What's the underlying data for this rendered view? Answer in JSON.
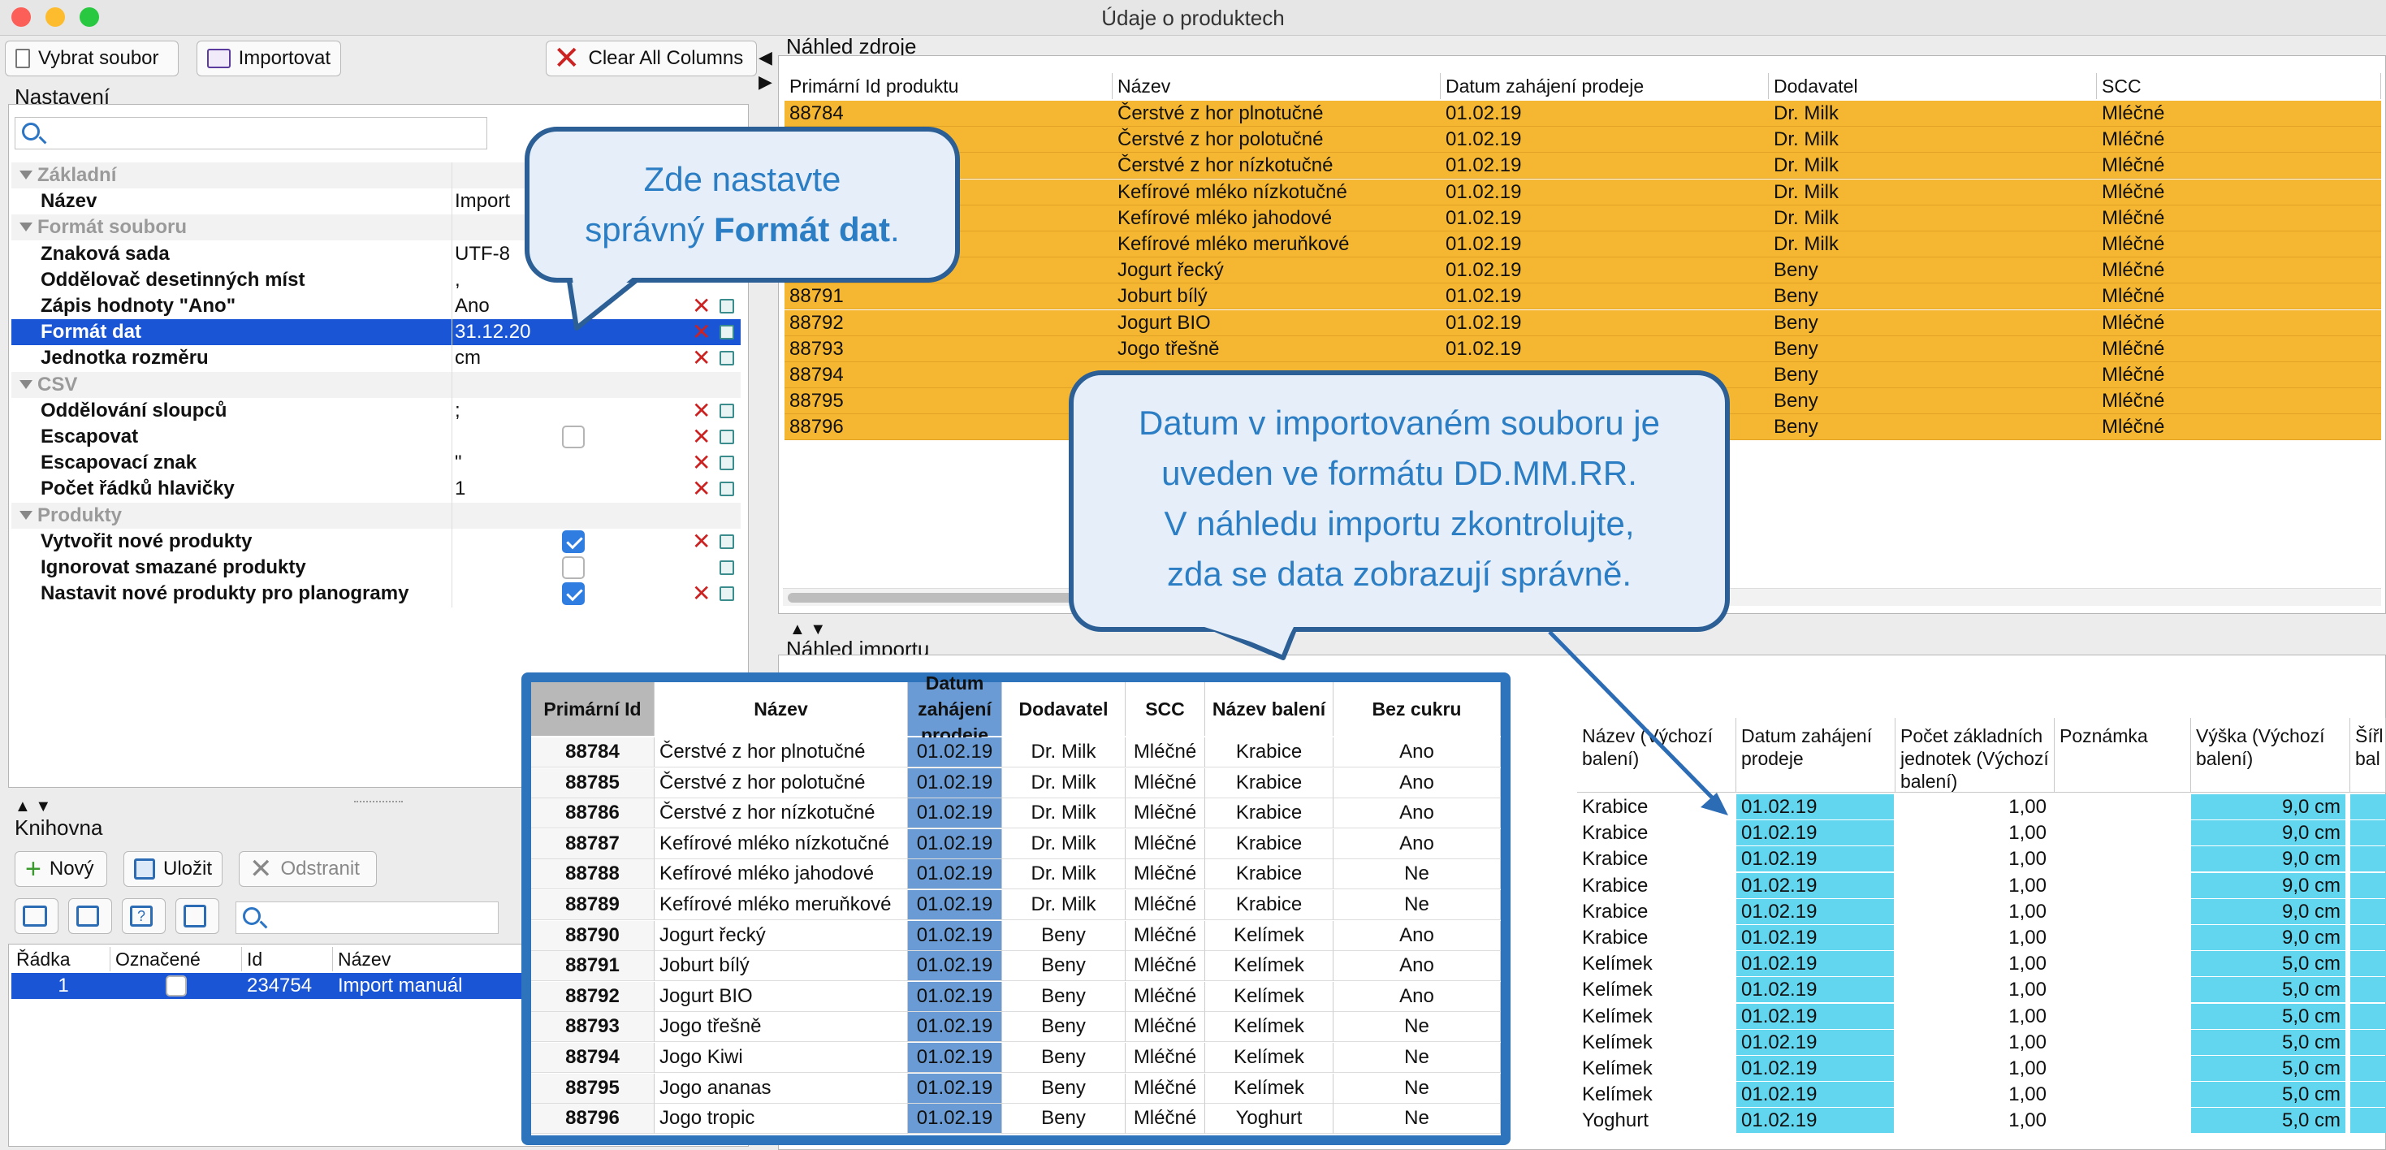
{
  "window": {
    "title": "Údaje o produktech"
  },
  "toolbar": {
    "select_file": "Vybrat soubor",
    "import": "Importovat",
    "clear_all": "Clear All Columns"
  },
  "settings": {
    "title": "Nastavení",
    "rows": [
      {
        "type": "group",
        "label": "Základní"
      },
      {
        "type": "prop",
        "label": "Název",
        "value": "Import",
        "icons": false
      },
      {
        "type": "group",
        "label": "Formát souboru"
      },
      {
        "type": "prop",
        "label": "Znaková sada",
        "value": "UTF-8",
        "icons": false
      },
      {
        "type": "prop",
        "label": "Oddělovač desetinných míst",
        "value": ",",
        "icons": false
      },
      {
        "type": "prop",
        "label": "Zápis hodnoty \"Ano\"",
        "value": "Ano",
        "icons": true
      },
      {
        "type": "prop",
        "label": "Formát dat",
        "value": "31.12.20",
        "icons": true,
        "selected": true
      },
      {
        "type": "prop",
        "label": "Jednotka rozměru",
        "value": "cm",
        "icons": true
      },
      {
        "type": "group",
        "label": "CSV"
      },
      {
        "type": "prop",
        "label": "Oddělování sloupců",
        "value": ";",
        "icons": true
      },
      {
        "type": "prop",
        "label": "Escapovat",
        "value": "",
        "checkbox": false,
        "icons": true
      },
      {
        "type": "prop",
        "label": "Escapovací znak",
        "value": "\"",
        "icons": true
      },
      {
        "type": "prop",
        "label": "Počet řádků hlavičky",
        "value": "1",
        "align": "right",
        "icons": true
      },
      {
        "type": "group",
        "label": "Produkty"
      },
      {
        "type": "prop",
        "label": "Vytvořit nové produkty",
        "value": "",
        "checkbox": true,
        "icons": true
      },
      {
        "type": "prop",
        "label": "Ignorovat smazané produkty",
        "value": "",
        "checkbox": false,
        "icons": "copy"
      },
      {
        "type": "prop",
        "label": "Nastavit nové produkty pro planogramy",
        "value": "",
        "checkbox": true,
        "icons": true
      }
    ]
  },
  "library": {
    "title": "Knihovna",
    "new": "Nový",
    "save": "Uložit",
    "delete": "Odstranit",
    "columns": [
      "Řádka",
      "Označené",
      "Id",
      "Název"
    ],
    "rows": [
      {
        "row": "1",
        "id": "234754",
        "name": "Import manuál"
      }
    ]
  },
  "source_preview": {
    "title": "Náhled zdroje",
    "columns": [
      "Primární Id produktu",
      "Název",
      "Datum zahájení prodeje",
      "Dodavatel",
      "SCC"
    ],
    "rows": [
      [
        "88784",
        "Čerstvé z hor plnotučné",
        "01.02.19",
        "Dr. Milk",
        "Mléčné"
      ],
      [
        "",
        "Čerstvé z hor polotučné",
        "01.02.19",
        "Dr. Milk",
        "Mléčné"
      ],
      [
        "",
        "Čerstvé z hor nízkotučné",
        "01.02.19",
        "Dr. Milk",
        "Mléčné"
      ],
      [
        "",
        "Kefírové mléko nízkotučné",
        "01.02.19",
        "Dr. Milk",
        "Mléčné"
      ],
      [
        "",
        "Kefírové mléko jahodové",
        "01.02.19",
        "Dr. Milk",
        "Mléčné"
      ],
      [
        "",
        "Kefírové mléko meruňkové",
        "01.02.19",
        "Dr. Milk",
        "Mléčné"
      ],
      [
        "",
        "Jogurt řecký",
        "01.02.19",
        "Beny",
        "Mléčné"
      ],
      [
        "88791",
        "Joburt bílý",
        "01.02.19",
        "Beny",
        "Mléčné"
      ],
      [
        "88792",
        "Jogurt BIO",
        "01.02.19",
        "Beny",
        "Mléčné"
      ],
      [
        "88793",
        "Jogo třešně",
        "01.02.19",
        "Beny",
        "Mléčné"
      ],
      [
        "88794",
        "",
        "",
        "Beny",
        "Mléčné"
      ],
      [
        "88795",
        "",
        "",
        "Beny",
        "Mléčné"
      ],
      [
        "88796",
        "",
        "",
        "Beny",
        "Mléčné"
      ]
    ]
  },
  "import_preview": {
    "title": "Náhled importu",
    "columns": [
      "Název (Výchozí balení)",
      "Datum zahájení prodeje",
      "Počet základních jednotek (Výchozí balení)",
      "Poznámka",
      "Výška (Výchozí balení)",
      "Šířl bal"
    ],
    "rows": [
      [
        "Krabice",
        "01.02.19",
        "1,00",
        "",
        "9,0 cm"
      ],
      [
        "Krabice",
        "01.02.19",
        "1,00",
        "",
        "9,0 cm"
      ],
      [
        "Krabice",
        "01.02.19",
        "1,00",
        "",
        "9,0 cm"
      ],
      [
        "Krabice",
        "01.02.19",
        "1,00",
        "",
        "9,0 cm"
      ],
      [
        "Krabice",
        "01.02.19",
        "1,00",
        "",
        "9,0 cm"
      ],
      [
        "Krabice",
        "01.02.19",
        "1,00",
        "",
        "9,0 cm"
      ],
      [
        "Kelímek",
        "01.02.19",
        "1,00",
        "",
        "5,0 cm"
      ],
      [
        "Kelímek",
        "01.02.19",
        "1,00",
        "",
        "5,0 cm"
      ],
      [
        "Kelímek",
        "01.02.19",
        "1,00",
        "",
        "5,0 cm"
      ],
      [
        "Kelímek",
        "01.02.19",
        "1,00",
        "",
        "5,0 cm"
      ],
      [
        "Kelímek",
        "01.02.19",
        "1,00",
        "",
        "5,0 cm"
      ],
      [
        "Kelímek",
        "01.02.19",
        "1,00",
        "",
        "5,0 cm"
      ],
      [
        "Yoghurt",
        "01.02.19",
        "1,00",
        "",
        "5,0 cm"
      ]
    ]
  },
  "callout1": {
    "line1": "Zde nastavte",
    "line2_pre": "správný ",
    "line2_bold": "Formát dat",
    "line2_post": "."
  },
  "callout2": {
    "lines": [
      "Datum v importovaném souboru je",
      "uveden ve formátu DD.MM.RR.",
      "V náhledu importu zkontrolujte,",
      "zda se data zobrazují správně."
    ]
  },
  "overlay": {
    "columns": [
      "Primární Id",
      "Název",
      "Datum zahájení prodeje",
      "Dodavatel",
      "SCC",
      "Název balení",
      "Bez cukru"
    ],
    "rows": [
      [
        "88784",
        "Čerstvé z hor plnotučné",
        "01.02.19",
        "Dr. Milk",
        "Mléčné",
        "Krabice",
        "Ano"
      ],
      [
        "88785",
        "Čerstvé z hor polotučné",
        "01.02.19",
        "Dr. Milk",
        "Mléčné",
        "Krabice",
        "Ano"
      ],
      [
        "88786",
        "Čerstvé z hor nízkotučné",
        "01.02.19",
        "Dr. Milk",
        "Mléčné",
        "Krabice",
        "Ano"
      ],
      [
        "88787",
        "Kefírové mléko nízkotučné",
        "01.02.19",
        "Dr. Milk",
        "Mléčné",
        "Krabice",
        "Ano"
      ],
      [
        "88788",
        "Kefírové mléko jahodové",
        "01.02.19",
        "Dr. Milk",
        "Mléčné",
        "Krabice",
        "Ne"
      ],
      [
        "88789",
        "Kefírové mléko meruňkové",
        "01.02.19",
        "Dr. Milk",
        "Mléčné",
        "Krabice",
        "Ne"
      ],
      [
        "88790",
        "Jogurt řecký",
        "01.02.19",
        "Beny",
        "Mléčné",
        "Kelímek",
        "Ano"
      ],
      [
        "88791",
        "Joburt bílý",
        "01.02.19",
        "Beny",
        "Mléčné",
        "Kelímek",
        "Ano"
      ],
      [
        "88792",
        "Jogurt BIO",
        "01.02.19",
        "Beny",
        "Mléčné",
        "Kelímek",
        "Ano"
      ],
      [
        "88793",
        "Jogo třešně",
        "01.02.19",
        "Beny",
        "Mléčné",
        "Kelímek",
        "Ne"
      ],
      [
        "88794",
        "Jogo Kiwi",
        "01.02.19",
        "Beny",
        "Mléčné",
        "Kelímek",
        "Ne"
      ],
      [
        "88795",
        "Jogo ananas",
        "01.02.19",
        "Beny",
        "Mléčné",
        "Kelímek",
        "Ne"
      ],
      [
        "88796",
        "Jogo tropic",
        "01.02.19",
        "Beny",
        "Mléčné",
        "Yoghurt",
        "Ne"
      ]
    ]
  },
  "colors": {
    "row_highlight": "#f5b731",
    "date_highlight": "#62d6ef",
    "selection": "#1a55d6",
    "overlay_border": "#2d74bd",
    "overlay_date_col": "#6a9bd4"
  }
}
